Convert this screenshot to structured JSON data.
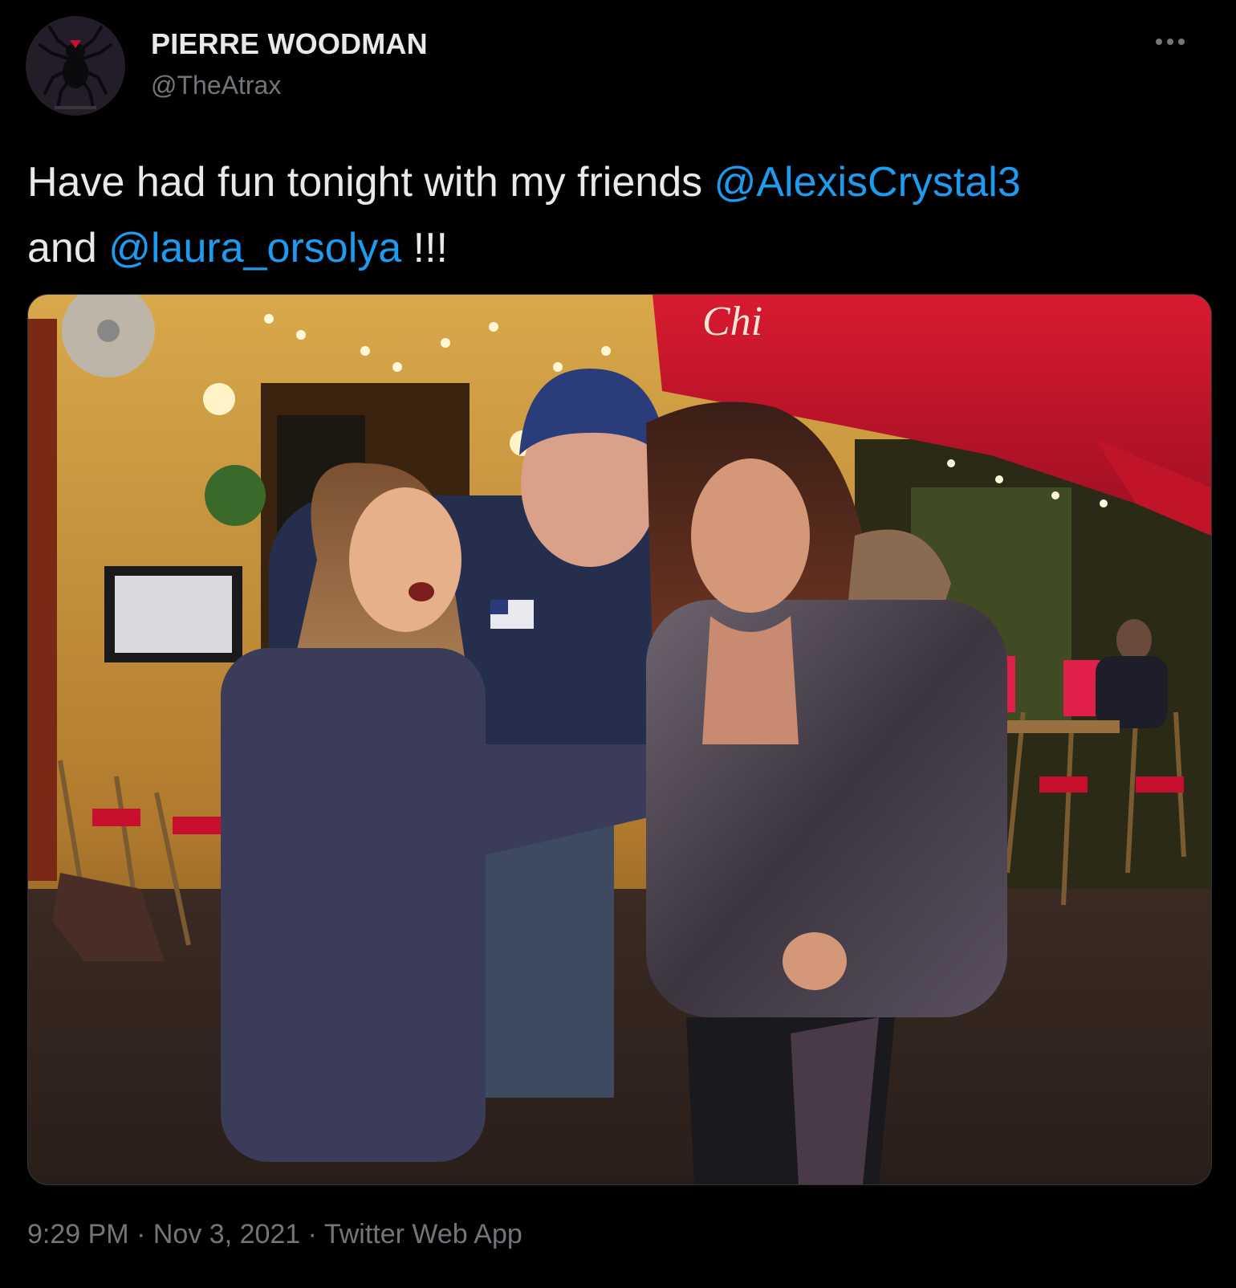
{
  "user": {
    "display_name": "PIERRE WOODMAN",
    "handle": "@TheAtrax",
    "avatar_icon": "spider-logo-icon"
  },
  "menu": {
    "more_icon": "more-horizontal-icon"
  },
  "tweet": {
    "text_1": "Have had fun tonight with my friends ",
    "mention_1": "@AlexisCrystal3",
    "text_2": "and ",
    "mention_2": "@laura_orsolya",
    "text_3": " !!!"
  },
  "media": {
    "image_icon": "photo-image",
    "awning_text": "Chi"
  },
  "meta": {
    "time": "9:29 PM",
    "separator": "·",
    "date": "Nov 3, 2021",
    "source": "Twitter Web App"
  },
  "colors": {
    "background": "#000000",
    "text": "#e7e9ea",
    "secondary": "#71767b",
    "link": "#1d9bf0"
  }
}
